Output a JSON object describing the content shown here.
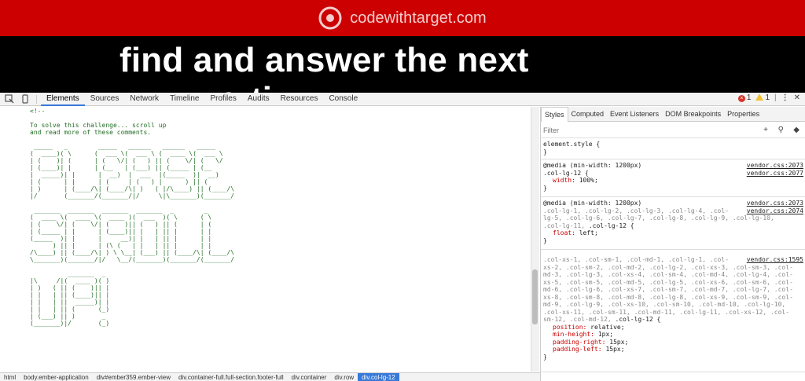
{
  "site": {
    "name": "codewithtarget.com",
    "hero_text": "find and answer the next",
    "hero_sub": "q    ti"
  },
  "devtools": {
    "tabs": [
      "Elements",
      "Sources",
      "Network",
      "Timeline",
      "Profiles",
      "Audits",
      "Resources",
      "Console"
    ],
    "active_tab": "Elements",
    "error_count": "1",
    "warning_count": "1",
    "elements": {
      "comment_open": "<!--",
      "comment_lines": [
        "To solve this challenge... scroll up",
        "and read more of these comments."
      ]
    },
    "styles_tabs": [
      "Styles",
      "Computed",
      "Event Listeners",
      "DOM Breakpoints",
      "Properties"
    ],
    "filter_placeholder": "Filter",
    "rules": {
      "r0": {
        "selector": "element.style {",
        "close": "}"
      },
      "r1": {
        "media": "@media (min-width: 1200px)",
        "media_src": "vendor.css:2073",
        "selector": ".col-lg-12 {",
        "src": "vendor.css:2077",
        "prop": "width",
        "val": "100%;",
        "close": "}"
      },
      "r2": {
        "media": "@media (min-width: 1200px)",
        "media_src": "vendor.css:2073",
        "sel_dim_1": ".col-lg-1, .col-lg-2, .col-lg-3, .col-lg-4, .col-",
        "src": "vendor.css:2074",
        "sel_dim_2": "lg-5, .col-lg-6, .col-lg-7, .col-lg-8, .col-lg-9, .col-lg-10,",
        "sel_dim_3": ".col-lg-11,",
        "sel_main": ".col-lg-12 {",
        "prop": "float",
        "val": "left;",
        "close": "}"
      },
      "r3": {
        "src": "vendor.css:1595",
        "lines": [
          ".col-xs-1, .col-sm-1, .col-md-1, .col-lg-1, .col-",
          "xs-2, .col-sm-2, .col-md-2, .col-lg-2, .col-xs-3, .col-sm-3, .col-",
          "md-3, .col-lg-3, .col-xs-4, .col-sm-4, .col-md-4, .col-lg-4, .col-",
          "xs-5, .col-sm-5, .col-md-5, .col-lg-5, .col-xs-6, .col-sm-6, .col-",
          "md-6, .col-lg-6, .col-xs-7, .col-sm-7, .col-md-7, .col-lg-7, .col-",
          "xs-8, .col-sm-8, .col-md-8, .col-lg-8, .col-xs-9, .col-sm-9, .col-",
          "md-9, .col-lg-9, .col-xs-10, .col-sm-10, .col-md-10, .col-lg-10,",
          ".col-xs-11, .col-sm-11, .col-md-11, .col-lg-11, .col-xs-12, .col-",
          "sm-12, .col-md-12,"
        ],
        "sel_main": ".col-lg-12 {",
        "props": [
          {
            "p": "position",
            "v": "relative;"
          },
          {
            "p": "min-height",
            "v": "1px;"
          },
          {
            "p": "padding-right",
            "v": "15px;"
          },
          {
            "p": "padding-left",
            "v": "15px;"
          }
        ],
        "close": "}"
      }
    },
    "breadcrumb": [
      "html",
      "body.ember-application",
      "div#ember359.ember-view",
      "div.container-full.full-section.footer-full",
      "div.container",
      "div.row",
      "div.col-lg-12"
    ]
  },
  "colors": {
    "header_red": "#cc0000",
    "ascii_green": "#236e25",
    "accent_blue": "#3879d9",
    "css_prop_red": "#c80000"
  }
}
